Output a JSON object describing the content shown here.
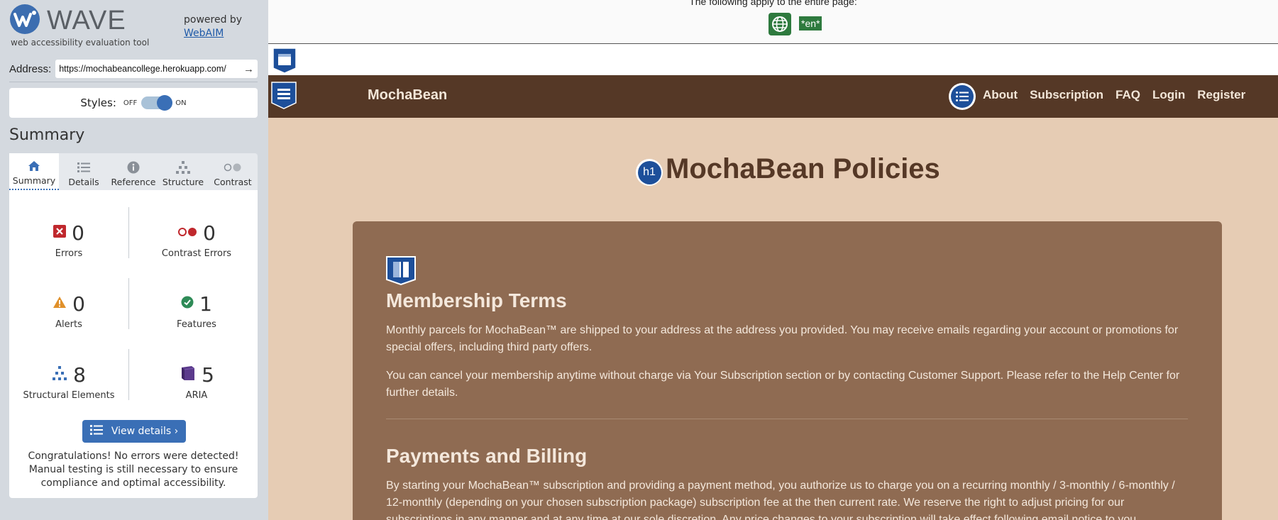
{
  "wave": {
    "brand_name": "WAVE",
    "tagline": "web accessibility evaluation tool",
    "powered_by": "powered by",
    "webaim_link": "WebAIM",
    "address_label": "Address:",
    "address_value": "https://mochabeancollege.herokuapp.com/",
    "styles_label": "Styles:",
    "styles_off": "OFF",
    "styles_on": "ON",
    "summary_heading": "Summary",
    "tabs": [
      {
        "label": "Summary",
        "icon": "home-icon"
      },
      {
        "label": "Details",
        "icon": "list-icon"
      },
      {
        "label": "Reference",
        "icon": "info-icon"
      },
      {
        "label": "Structure",
        "icon": "sitemap-icon"
      },
      {
        "label": "Contrast",
        "icon": "contrast-icon"
      }
    ],
    "stats": {
      "errors": {
        "count": "0",
        "label": "Errors"
      },
      "contrast_errors": {
        "count": "0",
        "label": "Contrast Errors"
      },
      "alerts": {
        "count": "0",
        "label": "Alerts"
      },
      "features": {
        "count": "1",
        "label": "Features"
      },
      "structural": {
        "count": "8",
        "label": "Structural Elements"
      },
      "aria": {
        "count": "5",
        "label": "ARIA"
      }
    },
    "view_details": "View details ›",
    "congrats": "Congratulations! No errors were detected! Manual testing is still necessary to ensure compliance and optimal accessibility."
  },
  "page": {
    "notice": "The following apply to the entire page:",
    "lang_tag": "*en*",
    "nav_brand": "MochaBean",
    "nav_links": [
      "About",
      "Subscription",
      "FAQ",
      "Login",
      "Register"
    ],
    "h1_badge": "h1",
    "title": "MochaBean Policies",
    "sections": [
      {
        "title": "Membership Terms",
        "paragraphs": [
          "Monthly parcels for MochaBean™ are shipped to your address at the address you provided. You may receive emails regarding your account or promotions for special offers, including third party offers.",
          "You can cancel your membership anytime without charge via Your Subscription section or by contacting Customer Support. Please refer to the Help Center for further details."
        ]
      },
      {
        "title": "Payments and Billing",
        "paragraphs": [
          "By starting your MochaBean™ subscription and providing a payment method, you authorize us to charge you on a recurring monthly / 3-monthly / 6-monthly / 12-monthly (depending on your chosen subscription package) subscription fee at the then current rate. We reserve the right to adjust pricing for our subscriptions in any manner and at any time at our sole discretion. Any price changes to your subscription will take effect following email notice to you."
        ]
      }
    ]
  },
  "colors": {
    "wave_blue": "#3a6fb6",
    "error_red": "#c0282d",
    "alert_orange": "#e0902a",
    "feature_green": "#2e8b57",
    "aria_purple": "#5b3a8c",
    "nav_brown": "#553826",
    "page_bg": "#e6ccb4",
    "card_bg": "#8f6b52"
  }
}
